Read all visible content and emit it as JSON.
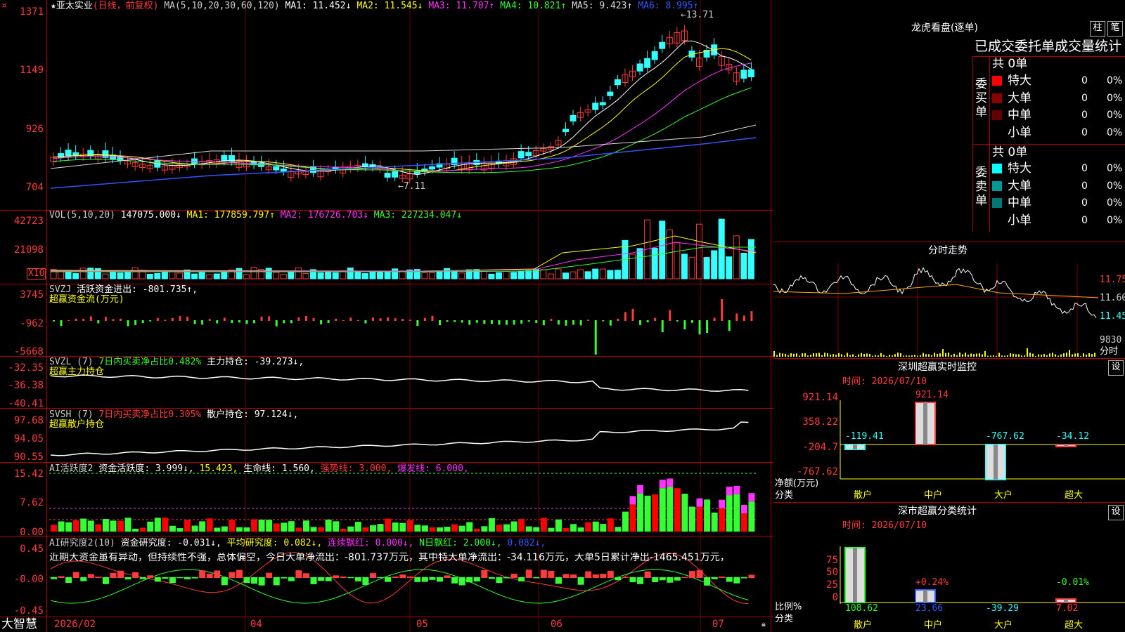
{
  "main_chart": {
    "title": "亚太实业",
    "mode": "(日线，前复权)",
    "ma_header": "MA(5,10,20,30,60,120)",
    "ma_values": [
      {
        "label": "MA1: 11.452↓",
        "color": "#ffffff"
      },
      {
        "label": "MA2: 11.545↓",
        "color": "#ffff00"
      },
      {
        "label": "MA3: 11.707↑",
        "color": "#ff33ff"
      },
      {
        "label": "MA4: 10.821↑",
        "color": "#33ff33"
      },
      {
        "label": "MA5: 9.423↑",
        "color": "#dddddd"
      },
      {
        "label": "MA6: 8.995↑",
        "color": "#3355ff"
      }
    ],
    "y_ticks": [
      "1371",
      "1149",
      "926",
      "704"
    ],
    "high_label": "13.71",
    "low_label": "7.11"
  },
  "volume_panel": {
    "header": "VOL(5,10,20)",
    "value": "147075.000↓",
    "ma1": "MA1: 177859.797↑",
    "ma2": "MA2: 176726.703↓",
    "ma3": "MA3: 227234.047↓",
    "y_ticks": [
      "42723",
      "21098"
    ],
    "unit": "X10"
  },
  "svzj_panel": {
    "header": "SVZJ",
    "value": "活跃资金进出: -801.735↑,",
    "subtitle": "超赢资金流(万元)",
    "y_ticks": [
      "3745",
      "-962",
      "-5668"
    ]
  },
  "svzl_panel": {
    "header": "SVZL (7)",
    "ratio": "7日内买卖净占比0.482%",
    "value": "主力持仓: -39.273↓,",
    "subtitle": "超赢主力持仓",
    "y_ticks": [
      "-32.35",
      "-36.38",
      "-40.41"
    ]
  },
  "svsh_panel": {
    "header": "SVSH (7)",
    "ratio": "7日内买卖净占比0.305%",
    "value": "散户持仓: 97.124↓,",
    "subtitle": "超赢散户持仓",
    "y_ticks": [
      "97.68",
      "94.05",
      "90.55"
    ]
  },
  "ai_active_panel": {
    "header": "AI活跃度2",
    "value": "资金活跃度: 3.999↓,",
    "v2": "15.423,",
    "v3": "生命线: 1.560,",
    "v4": "强势线: 3.000,",
    "v5": "爆发线: 6.000,",
    "y_ticks": [
      "15.42",
      "7.62",
      "0.00"
    ]
  },
  "ai_research_panel": {
    "header": "AI研究度2(10)",
    "value": "资金研究度: -0.031↓,",
    "v2": "平均研究度: 0.082↓,",
    "v3": "连续飘红: 0.000↓,",
    "v4": "N日飘红: 2.000↓,",
    "v5": "0.082↓,",
    "comment": "近期大资金虽有异动，但持续性不强，总体偏空，今日大单净流出：-801.737万元，其中特大单净流出：-34.116万元，大单5日累计净出-1465.451万元，",
    "y_ticks": [
      "0.45",
      "-0.00",
      "-0.45"
    ]
  },
  "bottom_bar": {
    "brand": "大智慧",
    "dates": [
      "2026/02",
      "04",
      "05",
      "06",
      "07"
    ]
  },
  "lhb_panel": {
    "title": "龙虎看盘(逐单)",
    "btn1": "柱",
    "btn2": "笔",
    "heading": "已成交委托单成交量统计",
    "buy_label": "委买单",
    "sell_label": "委卖单",
    "buy_total": "共 0单",
    "sell_total": "共 0单",
    "buy_rows": [
      {
        "name": "特大",
        "count": "0",
        "pct": "0%",
        "color": "#ff0000"
      },
      {
        "name": "大单",
        "count": "0",
        "pct": "0%",
        "color": "#8b0000"
      },
      {
        "name": "中单",
        "count": "0",
        "pct": "0%",
        "color": "#660000"
      },
      {
        "name": "小单",
        "count": "0",
        "pct": "0%",
        "color": "#000000"
      }
    ],
    "sell_rows": [
      {
        "name": "特大",
        "count": "0",
        "pct": "0%",
        "color": "#00ffff"
      },
      {
        "name": "大单",
        "count": "0",
        "pct": "0%",
        "color": "#009999"
      },
      {
        "name": "中单",
        "count": "0",
        "pct": "0%",
        "color": "#007777"
      },
      {
        "name": "小单",
        "count": "0",
        "pct": "0%",
        "color": "#000000"
      }
    ]
  },
  "intraday_panel": {
    "title": "分时走势",
    "y_ticks": [
      "11.75",
      "11.60",
      "11.45"
    ],
    "vol_label": "9830",
    "time_label": "分时"
  },
  "sz_monitor": {
    "title": "深圳超赢实时监控",
    "btn": "设",
    "time": "时间: 2026/07/10",
    "y_ticks": [
      "921.14",
      "358.22",
      "-204.7",
      "-767.62"
    ],
    "y_title": "净额(万元)",
    "x_title": "分类",
    "categories": [
      "散户",
      "中户",
      "大户",
      "超大"
    ],
    "values": [
      "-119.41",
      "921.14",
      "-767.62",
      "-34.12"
    ]
  },
  "sz_class": {
    "title": "深市超赢分类统计",
    "btn": "设",
    "time": "时间: 2026/07/10",
    "y_ticks": [
      "75",
      "50",
      "25",
      "0"
    ],
    "y_title": "比例%",
    "x_title": "分类",
    "categories": [
      "散户",
      "中户",
      "大户",
      "超大"
    ],
    "values": [
      "108.62",
      "23.66",
      "-39.29",
      "7.02"
    ],
    "pct_labels": [
      "",
      "+0.24%",
      "",
      "-0.01%"
    ]
  }
}
